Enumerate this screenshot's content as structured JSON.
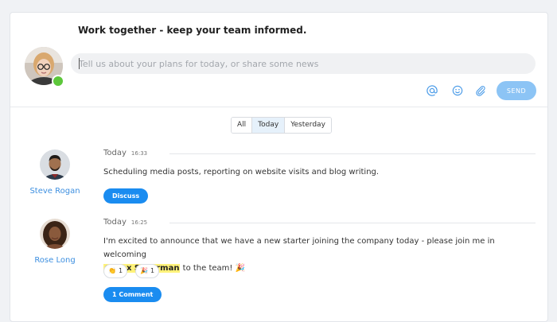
{
  "composer": {
    "headline": "Work together - keep your team informed.",
    "placeholder": "Tell us about your plans for today, or share some news",
    "send_label": "SEND",
    "tools": [
      "mention-icon",
      "emoji-icon",
      "attachment-icon"
    ]
  },
  "filter": {
    "tabs": [
      "All",
      "Today",
      "Yesterday"
    ],
    "active": "Today"
  },
  "posts": [
    {
      "author": "Steve Rogan",
      "day": "Today",
      "time": "16:33",
      "text": "Scheduling media posts, reporting on website visits and blog writing.",
      "action_label": "Discuss"
    },
    {
      "author": "Rose Long",
      "day": "Today",
      "time": "16:25",
      "text_before": "I'm excited to announce that we have a new starter joining the company today - please join me in welcoming",
      "mention": "@Alex Silverman",
      "text_after": "to the team! 🎉",
      "reactions": [
        {
          "emoji": "👏",
          "count": "1"
        },
        {
          "emoji": "🎉",
          "count": "1"
        }
      ],
      "action_label": "1 Comment"
    }
  ],
  "colors": {
    "accent": "#1a8cf0",
    "send_disabled": "#8cc4f5",
    "online": "#5dc73b",
    "link": "#3d8fe0",
    "mention_highlight": "#fff27a"
  }
}
